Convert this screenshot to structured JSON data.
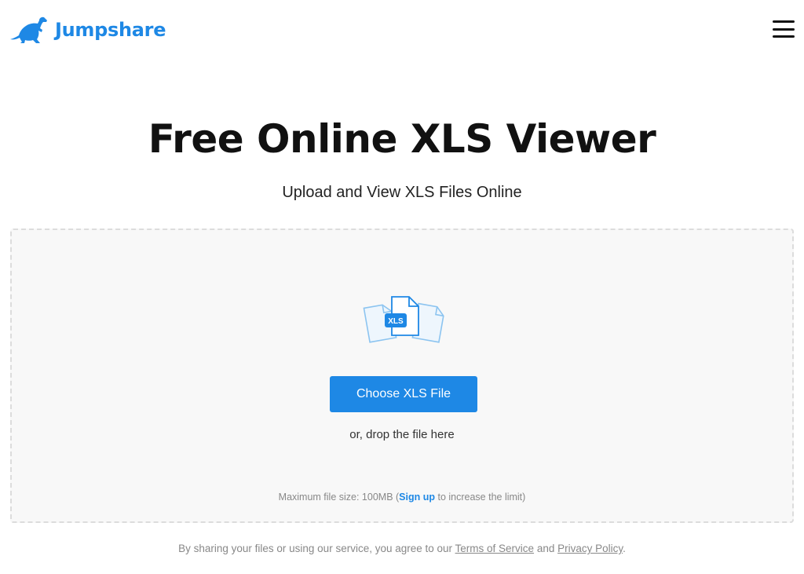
{
  "header": {
    "brand": "Jumpshare",
    "brand_color": "#1e88e5",
    "logo_icon": "kangaroo-icon",
    "menu_icon": "hamburger-menu-icon"
  },
  "hero": {
    "title": "Free Online XLS Viewer",
    "subtitle": "Upload and View XLS Files Online"
  },
  "dropzone": {
    "illustration_icon": "xls-files-icon",
    "file_badge": "XLS",
    "choose_button": "Choose XLS File",
    "drop_text": "or, drop the file here",
    "limit_prefix": "Maximum file size: 100MB (",
    "signup_link": "Sign up",
    "limit_suffix": " to increase the limit)"
  },
  "footer": {
    "prefix": "By sharing your files or using our service, you agree to our ",
    "terms_link": "Terms of Service",
    "conjunction": " and ",
    "privacy_link": "Privacy Policy",
    "suffix": "."
  },
  "colors": {
    "accent": "#1e88e5",
    "dropzone_bg": "#f8f8f8",
    "dropzone_border": "#dcdcdc"
  }
}
